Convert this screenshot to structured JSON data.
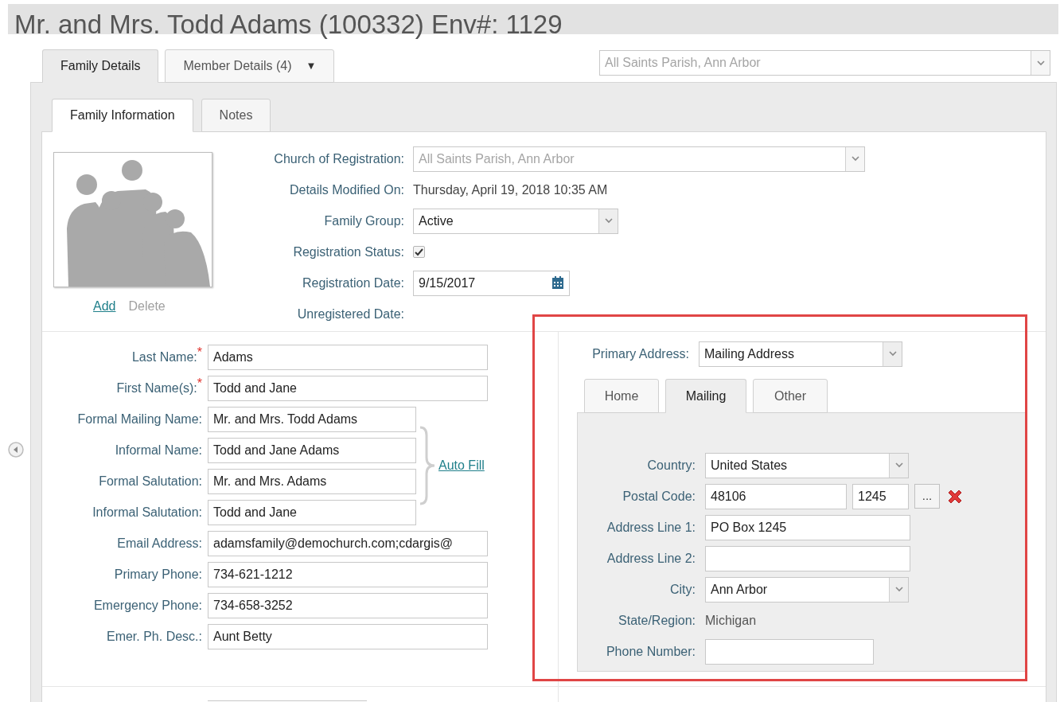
{
  "title": "Mr. and Mrs. Todd Adams (100332) Env#: 1129",
  "tabs": [
    {
      "label": "Family Details",
      "selected": true
    },
    {
      "label": "Member Details (4)",
      "selected": false,
      "caret": "▼"
    }
  ],
  "parish_select": {
    "value": "All Saints Parish, Ann Arbor",
    "disabled": true
  },
  "subtabs": [
    {
      "label": "Family Information",
      "selected": true
    },
    {
      "label": "Notes",
      "selected": false
    }
  ],
  "photo_links": [
    {
      "label": "Add",
      "disabled": false
    },
    {
      "label": "Delete",
      "disabled": true
    }
  ],
  "family_fields": [
    {
      "label": "Church of Registration:",
      "kind": "select",
      "value": "All Saints Parish, Ann Arbor",
      "disabled": true
    },
    {
      "label": "Details Modified On:",
      "kind": "text",
      "value": "Thursday, April 19, 2018 10:35 AM"
    },
    {
      "label": "Family Group:",
      "kind": "select",
      "value": "Active",
      "disabled": false
    },
    {
      "label": "Registration Status:",
      "kind": "checkbox",
      "checked": true
    },
    {
      "label": "Registration Date:",
      "kind": "date",
      "value": "9/15/2017"
    },
    {
      "label": "Unregistered Date:",
      "kind": "text"
    }
  ],
  "name_fields": [
    {
      "label": "Last Name:",
      "required_mark": "*",
      "value": "Adams"
    },
    {
      "label": "First Name(s):",
      "required_mark": "*",
      "value": "Todd and Jane"
    }
  ],
  "autofill_fields": [
    {
      "label": "Formal Mailing Name:",
      "value": "Mr. and Mrs. Todd Adams"
    },
    {
      "label": "Informal Name:",
      "value": "Todd and Jane Adams"
    },
    {
      "label": "Formal Salutation:",
      "value": "Mr. and Mrs. Adams"
    },
    {
      "label": "Informal Salutation:",
      "value": "Todd and Jane"
    }
  ],
  "autofill_link": "Auto Fill",
  "contact_fields": [
    {
      "label": "Email Address:",
      "value": "adamsfamily@demochurch.com;cdargis@"
    },
    {
      "label": "Primary Phone:",
      "value": "734-621-1212"
    },
    {
      "label": "Emergency Phone:",
      "value": "734-658-3252"
    },
    {
      "label": "Emer. Ph. Desc.:",
      "value": "Aunt Betty"
    }
  ],
  "primary_address": {
    "label": "Primary Address:",
    "value": "Mailing Address"
  },
  "address_tabs": [
    {
      "label": "Home",
      "selected": false
    },
    {
      "label": "Mailing",
      "selected": true
    },
    {
      "label": "Other",
      "selected": false
    }
  ],
  "address_fields": [
    {
      "label": "Country:",
      "kind": "select",
      "value": "United States"
    },
    {
      "label": "Postal Code:",
      "kind": "postal",
      "value": "48106",
      "extension": "1245",
      "lookup": "..."
    },
    {
      "label": "Address Line 1:",
      "kind": "input",
      "value": "PO Box 1245"
    },
    {
      "label": "Address Line 2:",
      "kind": "input"
    },
    {
      "label": "City:",
      "kind": "select",
      "value": "Ann Arbor"
    },
    {
      "label": "State/Region:",
      "kind": "text",
      "value": "Michigan"
    },
    {
      "label": "Phone Number:",
      "kind": "phone"
    }
  ]
}
